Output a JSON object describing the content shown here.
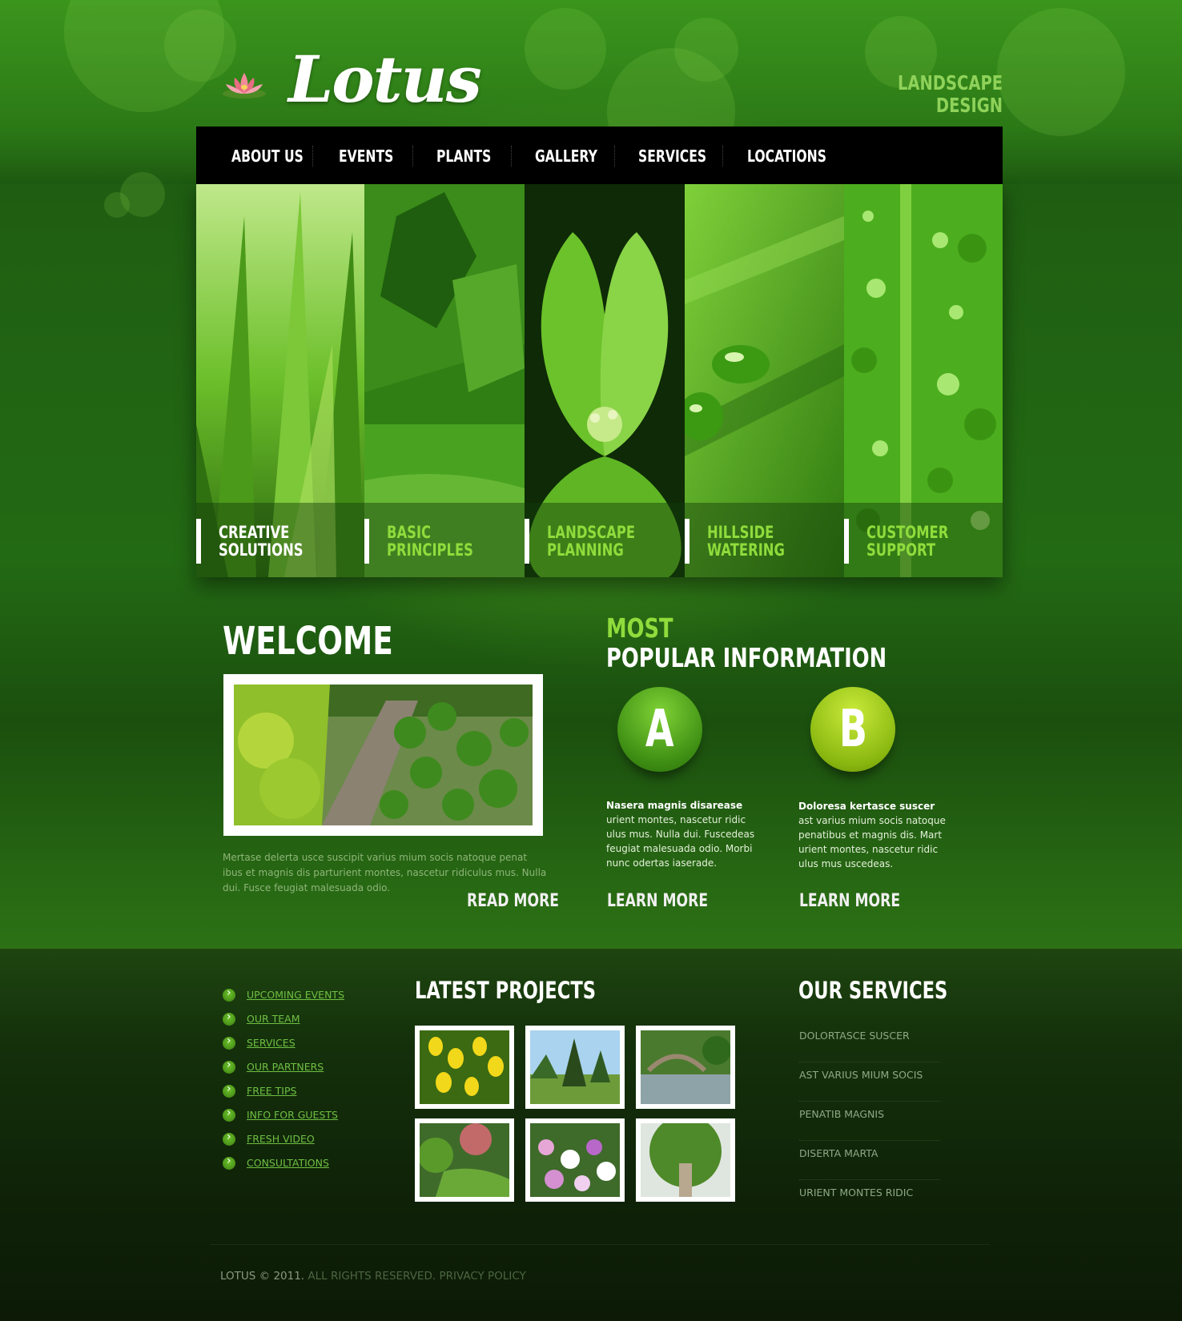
{
  "brand": {
    "name": "Lotus",
    "tagline_line1": "LANDSCAPE",
    "tagline_line2": "DESIGN"
  },
  "nav": {
    "items": [
      "ABOUT US",
      "EVENTS",
      "PLANTS",
      "GALLERY",
      "SERVICES",
      "LOCATIONS"
    ]
  },
  "banner": {
    "panels": [
      {
        "label": "CREATIVE\nSOLUTIONS",
        "color": "#ffffff"
      },
      {
        "label": "BASIC\nPRINCIPLES",
        "color": "#8fdc3c"
      },
      {
        "label": "LANDSCAPE\nPLANNING",
        "color": "#8fdc3c"
      },
      {
        "label": "HILLSIDE\nWATERING",
        "color": "#8fdc3c"
      },
      {
        "label": "CUSTOMER\nSUPPORT",
        "color": "#8fdc3c"
      }
    ]
  },
  "welcome": {
    "heading": "WELCOME",
    "text": "Mertase delerta usce suscipit varius mium socis natoque penat ibus et magnis dis parturient montes, nascetur ridiculus mus. Nulla dui. Fusce feugiat malesuada odio.",
    "read_more": "READ MORE"
  },
  "popular": {
    "heading_line1": "MOST",
    "heading_line2": "POPULAR INFORMATION",
    "items": [
      {
        "letter": "A",
        "title": "Nasera magnis disarease",
        "body": "urient montes, nascetur ridic ulus mus. Nulla dui. Fuscedeas feugiat malesuada odio. Morbi nunc odertas iaserade.",
        "link": "LEARN MORE"
      },
      {
        "letter": "B",
        "title": "Doloresa kertasce suscer",
        "body": "ast varius mium socis natoque penatibus et magnis dis. Mart urient montes, nascetur ridic ulus mus uscedeas.",
        "link": "LEARN MORE"
      }
    ]
  },
  "footer": {
    "links": [
      "UPCOMING EVENTS",
      "OUR TEAM",
      "SERVICES",
      "OUR PARTNERS",
      "FREE TIPS",
      "INFO FOR GUESTS",
      "FRESH VIDEO",
      "CONSULTATIONS"
    ],
    "projects_heading": "LATEST PROJECTS",
    "services_heading": "OUR SERVICES",
    "services": [
      "DOLORTASCE SUSCER",
      "AST VARIUS MIUM SOCIS",
      "PENATIB MAGNIS",
      "DISERTA MARTA",
      "URIENT MONTES RIDIC"
    ],
    "copyright_brand": "LOTUS © 2011.",
    "copyright_rights": "ALL RIGHTS RESERVED.",
    "privacy": "PRIVACY POLICY"
  }
}
